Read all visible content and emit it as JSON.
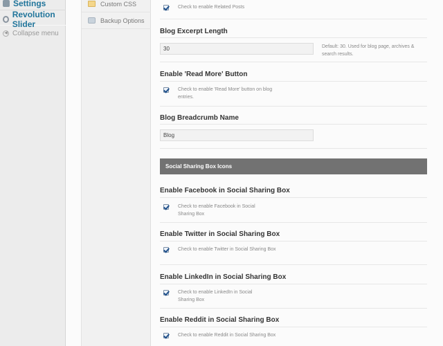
{
  "wp_menu": {
    "settings": "Settings",
    "revolution_slider": "Revolution Slider",
    "collapse": "Collapse menu"
  },
  "options_sidebar": {
    "custom_css": "Custom CSS",
    "backup_options": "Backup Options"
  },
  "main": {
    "related_posts": {
      "checkbox_label": "Check to enable Related Posts",
      "checked": true
    },
    "excerpt_length": {
      "title": "Blog Excerpt Length",
      "value": "30",
      "help": "Default: 30. Used for blog page, archives & search results."
    },
    "read_more": {
      "title": "Enable 'Read More' Button",
      "checkbox_label": "Check to enable 'Read More' button on blog entries.",
      "checked": true
    },
    "breadcrumb": {
      "title": "Blog Breadcrumb Name",
      "value": "Blog"
    },
    "banner": "Social Sharing Box Icons",
    "facebook": {
      "title": "Enable Facebook in Social Sharing Box",
      "checkbox_label": "Check to enable Facebook in Social Sharing Box",
      "checked": true
    },
    "twitter": {
      "title": "Enable Twitter in Social Sharing Box",
      "checkbox_label": "Check to enable Twitter in Social Sharing Box",
      "checked": true
    },
    "linkedin": {
      "title": "Enable LinkedIn in Social Sharing Box",
      "checkbox_label": "Check to enable LinkedIn in Social Sharing Box",
      "checked": true
    },
    "reddit": {
      "title": "Enable Reddit in Social Sharing Box",
      "checkbox_label": "Check to enable Reddit in Social Sharing Box",
      "checked": true
    }
  },
  "colors": {
    "link": "#21759b",
    "banner": "#727272"
  }
}
